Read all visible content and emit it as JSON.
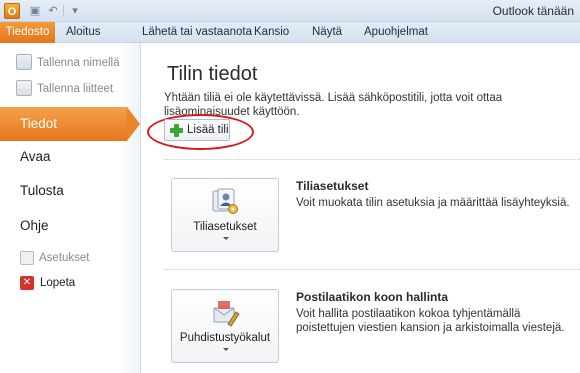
{
  "window": {
    "title": "Outlook tänään",
    "app_icon": "O"
  },
  "quick_access": {
    "save_icon": "save-icon",
    "undo_icon": "undo-icon",
    "customize_icon": "customize-quick-access-icon"
  },
  "tabs": [
    {
      "label": "Tiedosto",
      "active": true
    },
    {
      "label": "Aloitus"
    },
    {
      "label": "Lähetä tai vastaanota"
    },
    {
      "label": "Kansio"
    },
    {
      "label": "Näytä"
    },
    {
      "label": "Apuohjelmat"
    }
  ],
  "sidebar": {
    "save_as": "Tallenna nimellä",
    "save_attachments": "Tallenna liitteet",
    "info": "Tiedot",
    "open": "Avaa",
    "print": "Tulosta",
    "help": "Ohje",
    "options": "Asetukset",
    "exit": "Lopeta"
  },
  "content": {
    "title": "Tilin tiedot",
    "description": "Yhtään tiliä ei ole käytettävissä. Lisää sähköpostitili, jotta voit ottaa lisäominaisuudet käyttöön.",
    "add_account": "Lisää tili",
    "sections": [
      {
        "button_label": "Tiliasetukset",
        "title": "Tiliasetukset",
        "description": "Voit muokata tilin asetuksia ja määrittää lisäyhteyksiä."
      },
      {
        "button_label": "Puhdistustyökalut",
        "title": "Postilaatikon koon hallinta",
        "description": "Voit hallita postilaatikon kokoa tyhjentämällä poistettujen viestien kansion ja arkistoimalla viestejä."
      }
    ]
  },
  "colors": {
    "accent_orange": "#e5771d",
    "highlight_red": "#d61a1a",
    "plus_green": "#3aa735"
  }
}
